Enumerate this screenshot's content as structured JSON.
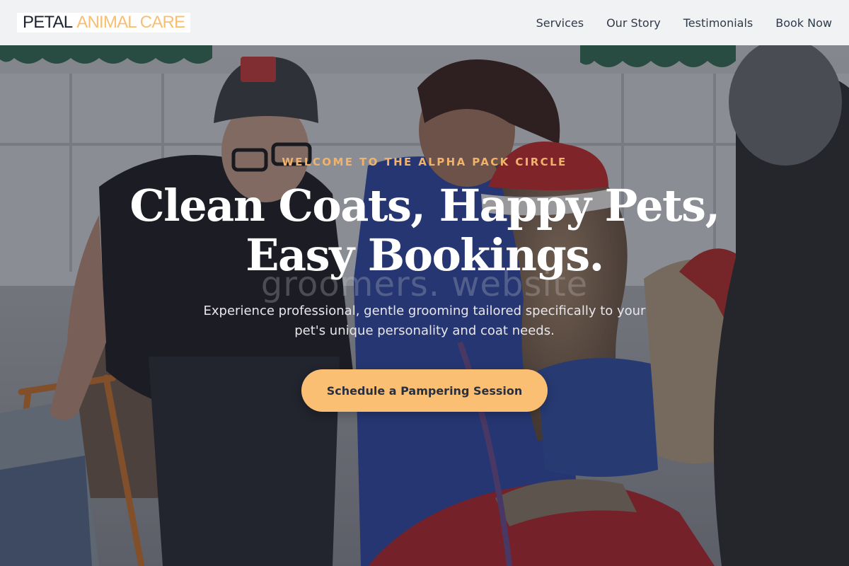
{
  "header": {
    "logo": {
      "main": "PETAL",
      "accent": "ANIMAL CARE"
    },
    "nav": [
      {
        "label": "Services"
      },
      {
        "label": "Our Story"
      },
      {
        "label": "Testimonials"
      },
      {
        "label": "Book Now"
      }
    ]
  },
  "hero": {
    "eyebrow": "WELCOME TO THE ALPHA PACK CIRCLE",
    "headline_line1": "Clean Coats, Happy Pets,",
    "headline_line2": "Easy Bookings.",
    "watermark": "groomers. website",
    "subtitle": "Experience professional, gentle grooming tailored specifically to your pet's unique personality and coat needs.",
    "cta_label": "Schedule a Pampering Session",
    "image_subject": "groomers-with-alpaca-in-santa-hat"
  },
  "colors": {
    "brand_dark": "#1c2433",
    "brand_accent": "#f7bf72",
    "eyebrow": "#f1b36c",
    "cta_bg": "#fbbf74",
    "cta_text": "#2a2f3d",
    "nav_text": "#2f3a4d",
    "header_bg": "#f1f2f3"
  }
}
